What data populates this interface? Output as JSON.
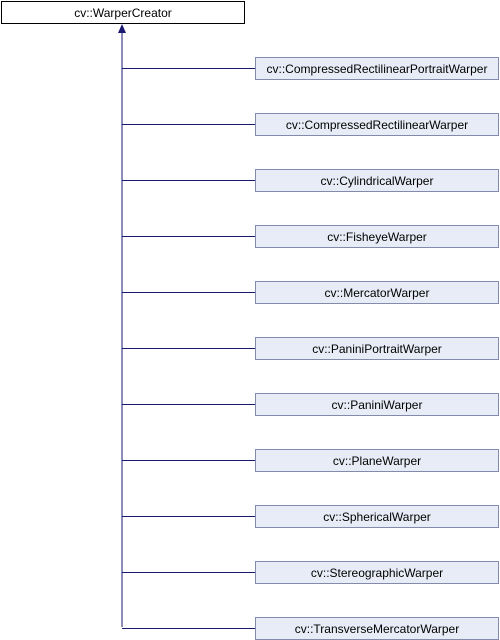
{
  "diagram": {
    "base_class": "cv::WarperCreator",
    "derived_classes": [
      "cv::CompressedRectilinearPortraitWarper",
      "cv::CompressedRectilinearWarper",
      "cv::CylindricalWarper",
      "cv::FisheyeWarper",
      "cv::MercatorWarper",
      "cv::PaniniPortraitWarper",
      "cv::PaniniWarper",
      "cv::PlaneWarper",
      "cv::SphericalWarper",
      "cv::StereographicWarper",
      "cv::TransverseMercatorWarper"
    ],
    "colors": {
      "edge": "#191970",
      "base_border": "#000000",
      "base_fill": "#ffffff",
      "derived_border": "#848aab",
      "derived_fill": "#e8ecf6"
    }
  }
}
